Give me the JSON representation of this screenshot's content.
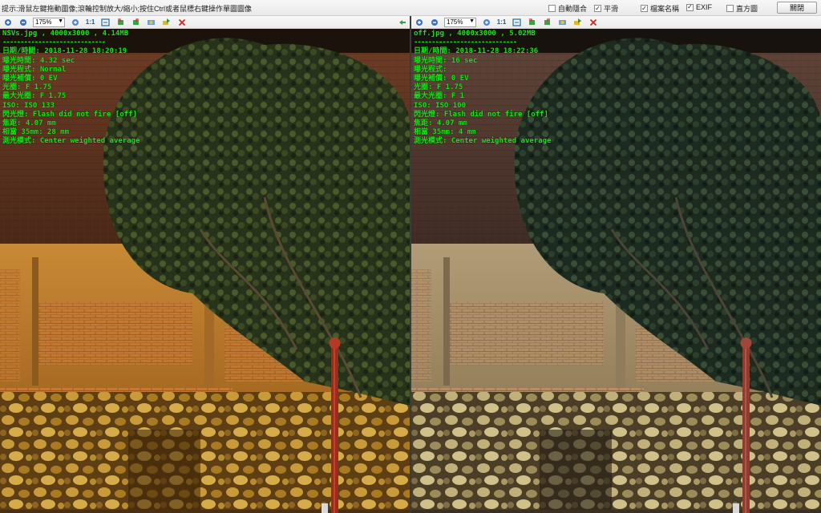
{
  "top": {
    "hint": "提示:滑鼠左鍵拖動圖像;滾輪控制放大/縮小;按住Ctrl或者鼠標右鍵操作單圖圖像",
    "options": [
      {
        "label": "自動隱合",
        "checked": false
      },
      {
        "label": "平滑",
        "checked": true
      },
      {
        "label": "檔案名稱",
        "checked": true
      },
      {
        "label": "EXIF",
        "checked": true
      },
      {
        "label": "直方圖",
        "checked": false
      }
    ],
    "close_label": "關閉"
  },
  "left": {
    "zoom": "175%",
    "fit_label": "1:1",
    "header": "NSVs.jpg , 4000x3000 , 4.14MB",
    "separator": "-----------------------------",
    "exif": [
      "日期/時間: 2018-11-28 18:20:19",
      "曝光時間: 4.32 sec",
      "曝光程式: Normal",
      "曝光補償: 0 EV",
      "光圈: F 1.75",
      "最大光圈: F 1.75",
      "ISO: ISO 133",
      "閃光燈: Flash did not fire [off]",
      "焦距: 4.07 mm",
      "相當 35mm: 28 mm",
      "測光模式: Center weighted average"
    ],
    "tone": "#c9892e"
  },
  "right": {
    "zoom": "175%",
    "fit_label": "1:1",
    "header": "off.jpg , 4000x3000 , 5.02MB",
    "separator": "-----------------------------",
    "exif": [
      "日期/時間: 2018-11-28 18:22:36",
      "曝光時間: 16 sec",
      "曝光程式:",
      "曝光補償: 0 EV",
      "光圈: F 1.75",
      "最大光圈: F 1",
      "ISO: ISO 100",
      "閃光燈: Flash did not fire [off]",
      "焦距: 4.07 mm",
      "相當 35mm: 4 mm",
      "測光模式: Center weighted average"
    ],
    "tone": "#b3a07a"
  },
  "icons": {
    "zoom_in": "zoom-in-icon",
    "zoom_out": "zoom-out-icon",
    "fit": "fit-window-icon",
    "rotate_left": "rotate-left-icon",
    "rotate_right": "rotate-right-icon",
    "flip": "flip-icon",
    "next": "next-icon",
    "delete": "delete-icon",
    "sync": "sync-arrow-icon"
  }
}
